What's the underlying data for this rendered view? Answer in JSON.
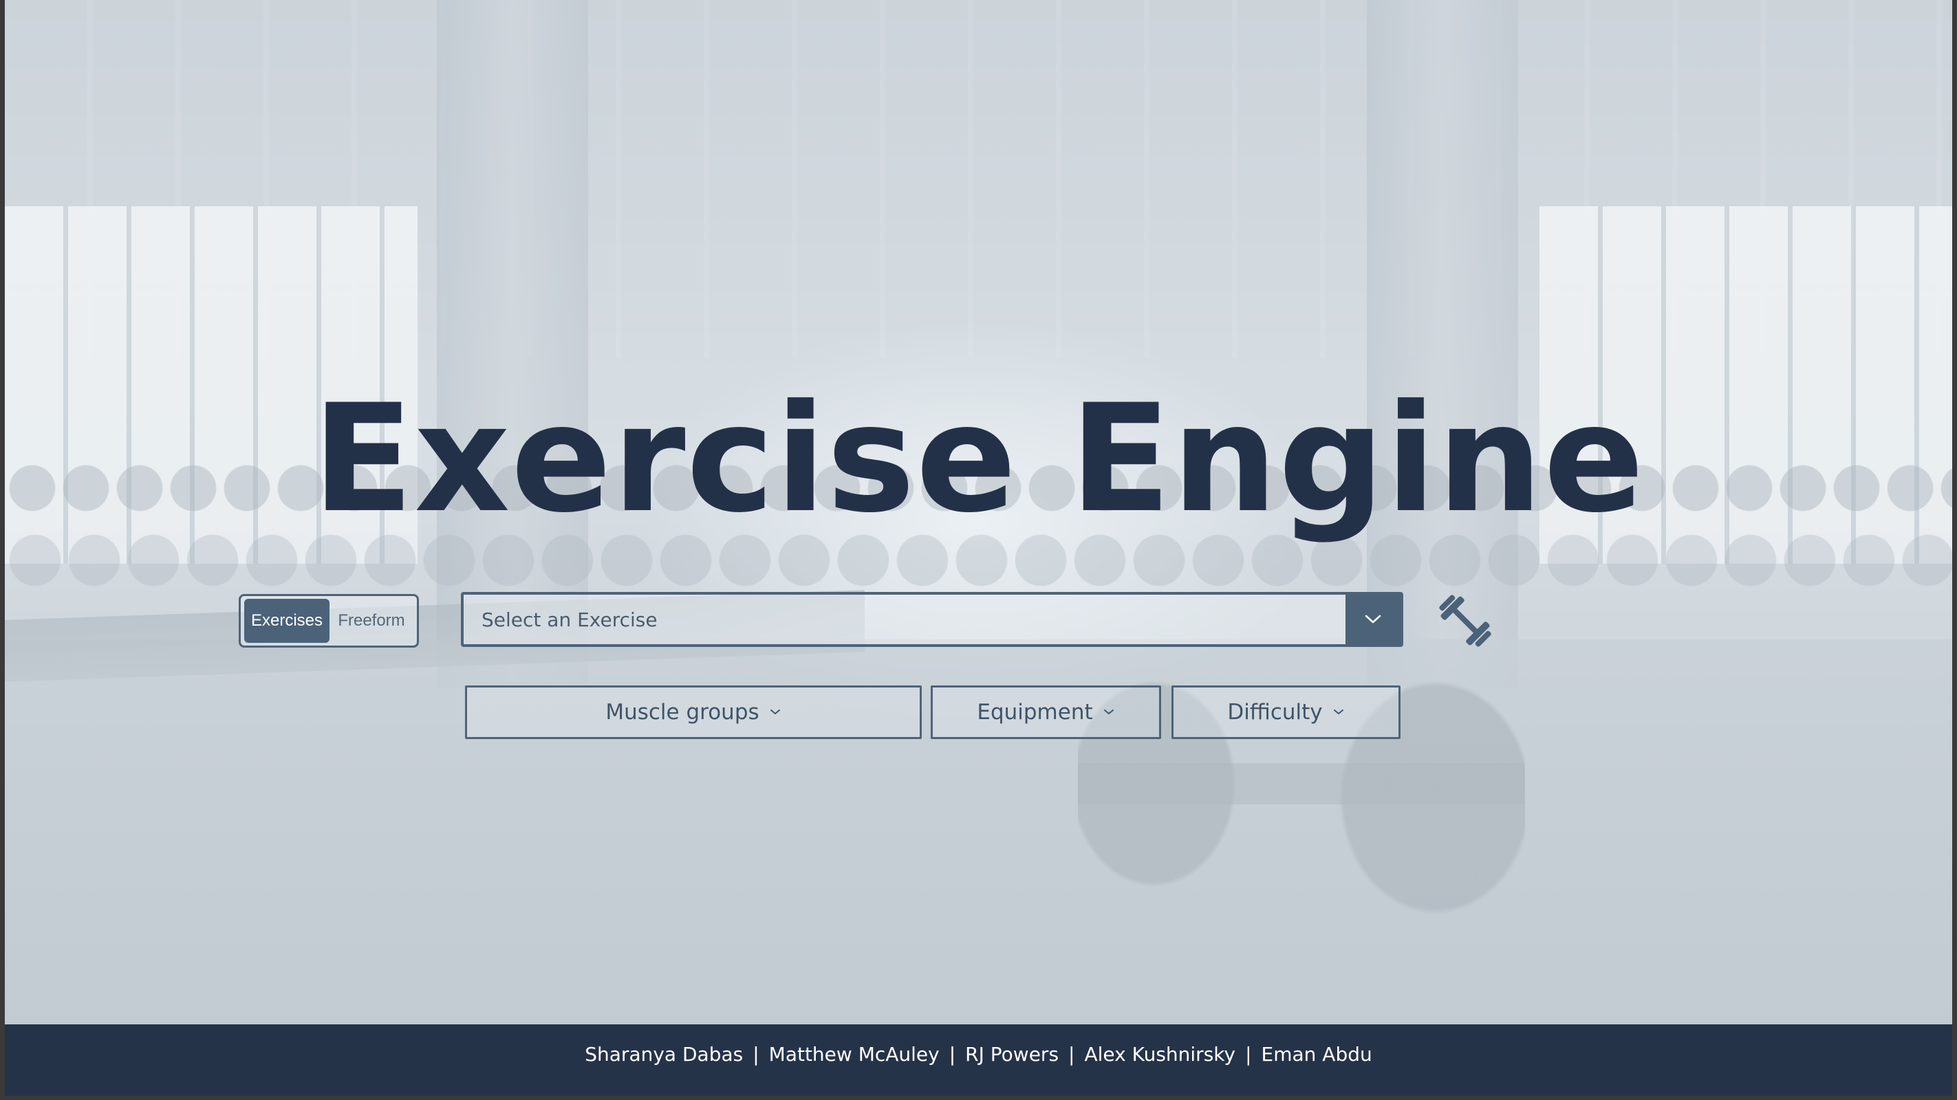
{
  "app": {
    "title": "Exercise Engine"
  },
  "mode_toggle": {
    "options": [
      {
        "label": "Exercises",
        "active": true
      },
      {
        "label": "Freeform",
        "active": false
      }
    ]
  },
  "exercise_select": {
    "placeholder": "Select an Exercise"
  },
  "filters": {
    "muscle_groups": "Muscle groups",
    "equipment": "Equipment",
    "difficulty": "Difficulty"
  },
  "footer": {
    "authors": [
      "Sharanya Dabas",
      "Matthew McAuley",
      "RJ Powers",
      "Alex Kushnirsky",
      "Eman Abdu"
    ],
    "separator": "|"
  },
  "icons": {
    "dumbbell": "dumbbell-icon",
    "select_caret": "chevron-down-icon",
    "filter_caret": "chevron-down-icon"
  },
  "colors": {
    "primary": "#233148",
    "accent": "#4b6279",
    "footer_bg": "#253349",
    "footer_text": "#ffffff"
  }
}
